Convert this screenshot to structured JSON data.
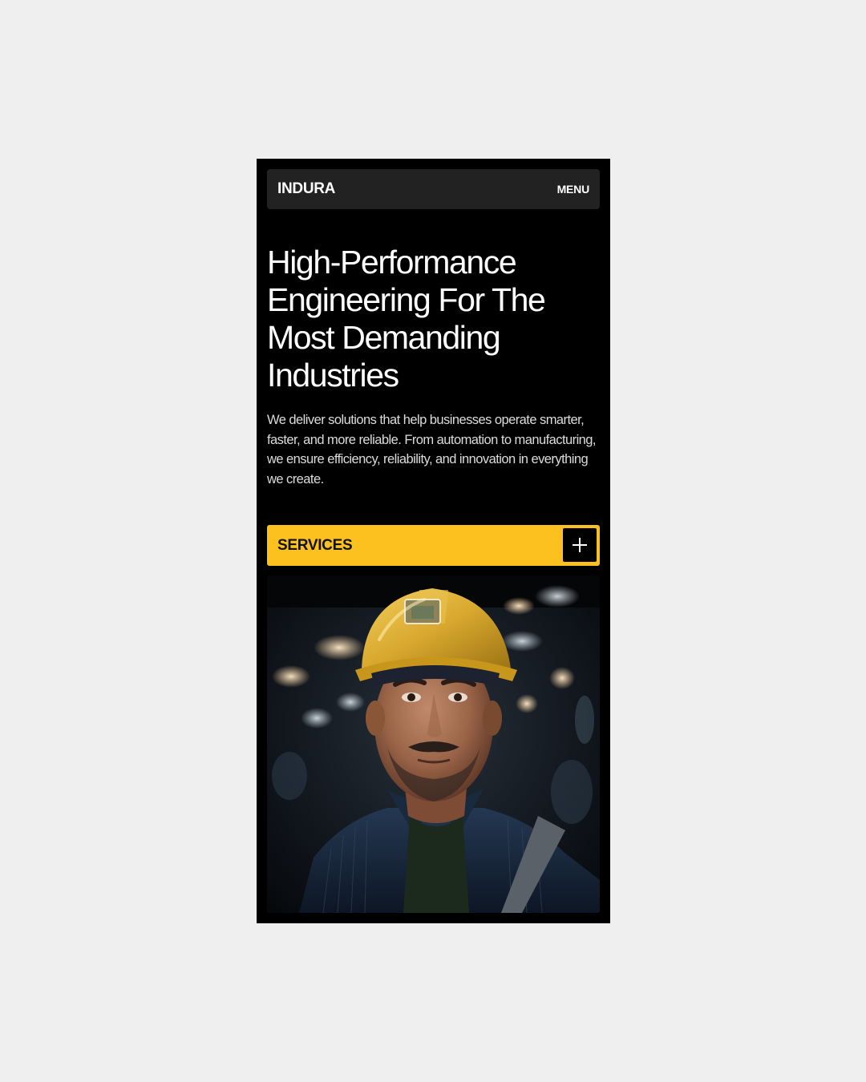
{
  "header": {
    "brand": "INDURA",
    "menu_label": "MENU"
  },
  "hero": {
    "title": "High-Performance Engineering For The Most Demanding Industries",
    "description": "We deliver solutions that help businesses operate smarter, faster, and more reliable. From automation to manufacturing, we ensure efficiency, reliability, and innovation in everything we create."
  },
  "services": {
    "label": "SERVICES",
    "icon": "plus-icon"
  },
  "colors": {
    "accent": "#fcc11f",
    "background": "#000000",
    "navbar": "#222222",
    "text": "#ffffff"
  }
}
